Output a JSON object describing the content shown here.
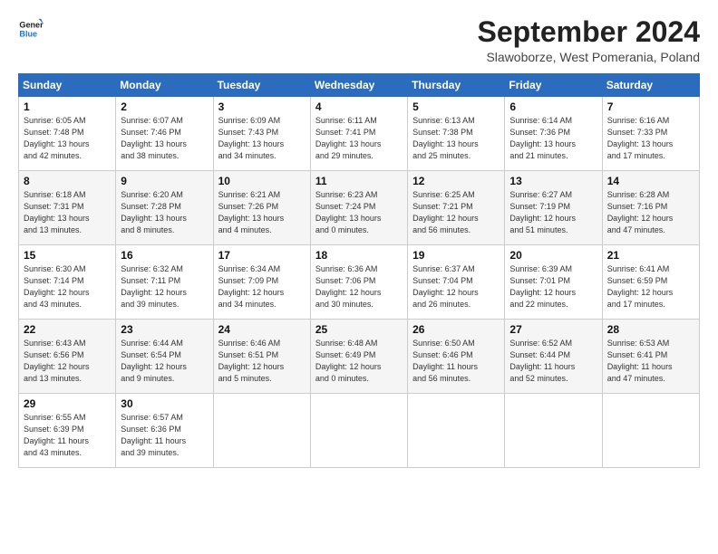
{
  "header": {
    "logo_line1": "General",
    "logo_line2": "Blue",
    "month_title": "September 2024",
    "subtitle": "Slawoborze, West Pomerania, Poland"
  },
  "days_of_week": [
    "Sunday",
    "Monday",
    "Tuesday",
    "Wednesday",
    "Thursday",
    "Friday",
    "Saturday"
  ],
  "weeks": [
    [
      {
        "day": "1",
        "info": "Sunrise: 6:05 AM\nSunset: 7:48 PM\nDaylight: 13 hours\nand 42 minutes."
      },
      {
        "day": "2",
        "info": "Sunrise: 6:07 AM\nSunset: 7:46 PM\nDaylight: 13 hours\nand 38 minutes."
      },
      {
        "day": "3",
        "info": "Sunrise: 6:09 AM\nSunset: 7:43 PM\nDaylight: 13 hours\nand 34 minutes."
      },
      {
        "day": "4",
        "info": "Sunrise: 6:11 AM\nSunset: 7:41 PM\nDaylight: 13 hours\nand 29 minutes."
      },
      {
        "day": "5",
        "info": "Sunrise: 6:13 AM\nSunset: 7:38 PM\nDaylight: 13 hours\nand 25 minutes."
      },
      {
        "day": "6",
        "info": "Sunrise: 6:14 AM\nSunset: 7:36 PM\nDaylight: 13 hours\nand 21 minutes."
      },
      {
        "day": "7",
        "info": "Sunrise: 6:16 AM\nSunset: 7:33 PM\nDaylight: 13 hours\nand 17 minutes."
      }
    ],
    [
      {
        "day": "8",
        "info": "Sunrise: 6:18 AM\nSunset: 7:31 PM\nDaylight: 13 hours\nand 13 minutes."
      },
      {
        "day": "9",
        "info": "Sunrise: 6:20 AM\nSunset: 7:28 PM\nDaylight: 13 hours\nand 8 minutes."
      },
      {
        "day": "10",
        "info": "Sunrise: 6:21 AM\nSunset: 7:26 PM\nDaylight: 13 hours\nand 4 minutes."
      },
      {
        "day": "11",
        "info": "Sunrise: 6:23 AM\nSunset: 7:24 PM\nDaylight: 13 hours\nand 0 minutes."
      },
      {
        "day": "12",
        "info": "Sunrise: 6:25 AM\nSunset: 7:21 PM\nDaylight: 12 hours\nand 56 minutes."
      },
      {
        "day": "13",
        "info": "Sunrise: 6:27 AM\nSunset: 7:19 PM\nDaylight: 12 hours\nand 51 minutes."
      },
      {
        "day": "14",
        "info": "Sunrise: 6:28 AM\nSunset: 7:16 PM\nDaylight: 12 hours\nand 47 minutes."
      }
    ],
    [
      {
        "day": "15",
        "info": "Sunrise: 6:30 AM\nSunset: 7:14 PM\nDaylight: 12 hours\nand 43 minutes."
      },
      {
        "day": "16",
        "info": "Sunrise: 6:32 AM\nSunset: 7:11 PM\nDaylight: 12 hours\nand 39 minutes."
      },
      {
        "day": "17",
        "info": "Sunrise: 6:34 AM\nSunset: 7:09 PM\nDaylight: 12 hours\nand 34 minutes."
      },
      {
        "day": "18",
        "info": "Sunrise: 6:36 AM\nSunset: 7:06 PM\nDaylight: 12 hours\nand 30 minutes."
      },
      {
        "day": "19",
        "info": "Sunrise: 6:37 AM\nSunset: 7:04 PM\nDaylight: 12 hours\nand 26 minutes."
      },
      {
        "day": "20",
        "info": "Sunrise: 6:39 AM\nSunset: 7:01 PM\nDaylight: 12 hours\nand 22 minutes."
      },
      {
        "day": "21",
        "info": "Sunrise: 6:41 AM\nSunset: 6:59 PM\nDaylight: 12 hours\nand 17 minutes."
      }
    ],
    [
      {
        "day": "22",
        "info": "Sunrise: 6:43 AM\nSunset: 6:56 PM\nDaylight: 12 hours\nand 13 minutes."
      },
      {
        "day": "23",
        "info": "Sunrise: 6:44 AM\nSunset: 6:54 PM\nDaylight: 12 hours\nand 9 minutes."
      },
      {
        "day": "24",
        "info": "Sunrise: 6:46 AM\nSunset: 6:51 PM\nDaylight: 12 hours\nand 5 minutes."
      },
      {
        "day": "25",
        "info": "Sunrise: 6:48 AM\nSunset: 6:49 PM\nDaylight: 12 hours\nand 0 minutes."
      },
      {
        "day": "26",
        "info": "Sunrise: 6:50 AM\nSunset: 6:46 PM\nDaylight: 11 hours\nand 56 minutes."
      },
      {
        "day": "27",
        "info": "Sunrise: 6:52 AM\nSunset: 6:44 PM\nDaylight: 11 hours\nand 52 minutes."
      },
      {
        "day": "28",
        "info": "Sunrise: 6:53 AM\nSunset: 6:41 PM\nDaylight: 11 hours\nand 47 minutes."
      }
    ],
    [
      {
        "day": "29",
        "info": "Sunrise: 6:55 AM\nSunset: 6:39 PM\nDaylight: 11 hours\nand 43 minutes."
      },
      {
        "day": "30",
        "info": "Sunrise: 6:57 AM\nSunset: 6:36 PM\nDaylight: 11 hours\nand 39 minutes."
      },
      {
        "day": "",
        "info": ""
      },
      {
        "day": "",
        "info": ""
      },
      {
        "day": "",
        "info": ""
      },
      {
        "day": "",
        "info": ""
      },
      {
        "day": "",
        "info": ""
      }
    ]
  ]
}
